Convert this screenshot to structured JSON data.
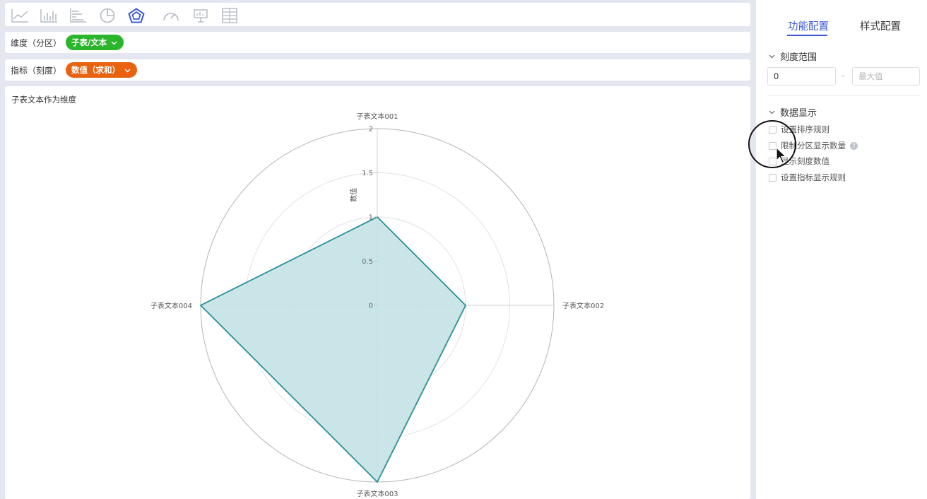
{
  "toolbar": {
    "icons": [
      "line-chart-icon",
      "bar-chart-icon",
      "horizontal-bar-chart-icon",
      "pie-chart-icon",
      "radar-chart-icon",
      "gauge-chart-icon",
      "presentation-chart-icon",
      "table-grid-icon"
    ],
    "active_icon": "radar-chart-icon",
    "active_color": "#3c5bd6",
    "inactive_color": "#b4b8c2"
  },
  "dimension": {
    "label": "维度（分区）",
    "pill": "子表/文本",
    "pill_color": "#2bb52b"
  },
  "measure": {
    "label": "指标（刻度）",
    "pill": "数值（求和）",
    "pill_color": "#e8620f"
  },
  "chart": {
    "title": "子表文本作为维度"
  },
  "chart_data": {
    "type": "radar",
    "title": "子表文本作为维度",
    "categories": [
      "子表文本001",
      "子表文本002",
      "子表文本003",
      "子表文本004"
    ],
    "series": [
      {
        "values": [
          1,
          1,
          2,
          2
        ]
      }
    ],
    "axis_label": "数值",
    "ticks": [
      "0",
      "0.5",
      "1",
      "1.5",
      "2"
    ],
    "range": [
      0,
      2
    ],
    "line_color": "#2a8f96",
    "fill_color": "#c4e2e5"
  },
  "panel": {
    "tabs": [
      {
        "label": "功能配置",
        "active": true
      },
      {
        "label": "样式配置",
        "active": false
      }
    ],
    "scale_section": {
      "title": "刻度范围",
      "min_value": "0",
      "max_placeholder": "最大值",
      "separator": "–"
    },
    "data_section": {
      "title": "数据显示",
      "options": [
        "设置排序规则",
        "限制分区显示数量",
        "显示刻度数值",
        "设置指标显示规则"
      ]
    }
  }
}
